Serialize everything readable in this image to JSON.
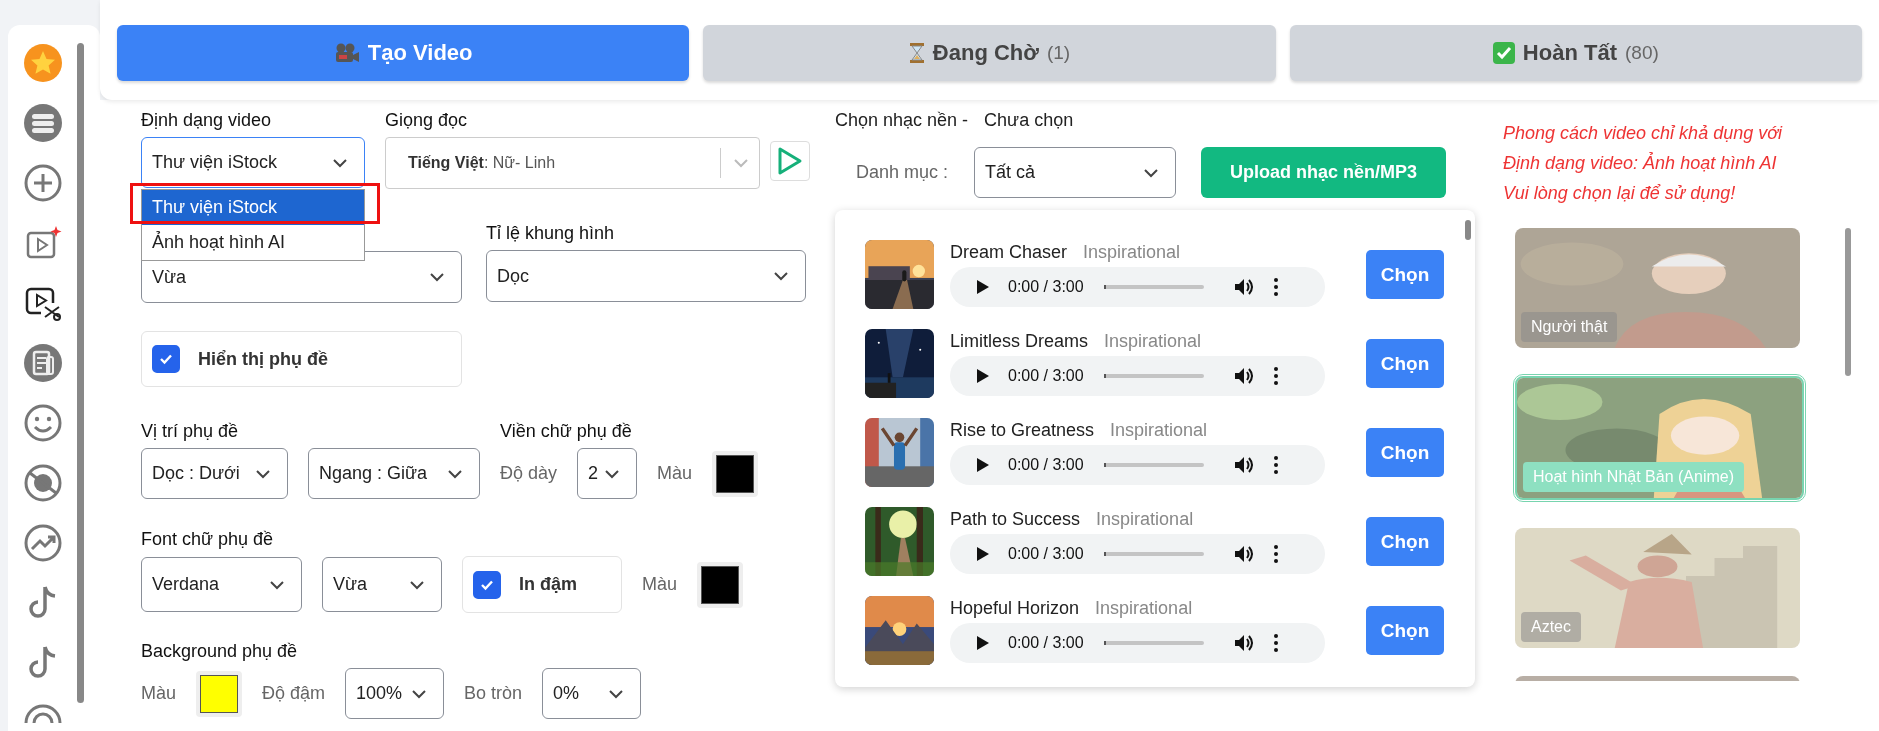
{
  "tabs": [
    {
      "label": "Tạo Video",
      "selected": true
    },
    {
      "label": "Đang Chờ",
      "count": "(1)",
      "selected": false
    },
    {
      "label": "Hoàn Tất",
      "count": "(80)",
      "selected": false
    }
  ],
  "form": {
    "video_format": {
      "label": "Định dạng video",
      "value": "Thư viện iStock",
      "options": [
        {
          "label": "Thư viện iStock",
          "selected": true,
          "highlighted": true
        },
        {
          "label": "Ảnh hoạt hình AI",
          "selected": false,
          "highlighted": false
        }
      ]
    },
    "voice": {
      "label": "Giọng đọc",
      "value": "**Tiếng Việt**: Nữ- Linh"
    },
    "size": {
      "value": "Vừa"
    },
    "aspect": {
      "label": "Tỉ lệ khung hình",
      "value": "Dọc"
    },
    "show_subtitles": {
      "label": "Hiển thị phụ đề",
      "checked": true
    },
    "subtitle_position": {
      "label": "Vị trí phụ đề",
      "vertical": "Dọc : Dưới",
      "horizontal": "Ngang : Giữa"
    },
    "subtitle_outline": {
      "label": "Viền chữ phụ đề",
      "thickness_label": "Độ dày",
      "thickness": "2",
      "color_label": "Màu",
      "color": "#000000"
    },
    "subtitle_font": {
      "label": "Font chữ phụ đề",
      "font": "Verdana",
      "size": "Vừa",
      "bold": {
        "label": "In đậm",
        "checked": true
      },
      "color_label": "Màu",
      "color": "#000000"
    },
    "subtitle_background": {
      "label": "Background phụ đề",
      "color_label": "Màu",
      "color": "#ffff00",
      "opacity_label": "Độ đậm",
      "opacity": "100%",
      "radius_label": "Bo tròn",
      "radius": "0%"
    }
  },
  "music": {
    "title": "Chọn nhạc nền -",
    "status": "Chưa chọn",
    "category_label": "Danh mục :",
    "category": "Tất cả",
    "upload_button": "Upload nhạc nền/MP3",
    "tracks": [
      {
        "title": "Dream Chaser",
        "genre": "Inspirational",
        "time": "0:00 / 3:00",
        "level": 0,
        "button": "Chọn"
      },
      {
        "title": "Limitless Dreams",
        "genre": "Inspirational",
        "time": "0:00 / 3:00",
        "level": 0,
        "button": "Chọn"
      },
      {
        "title": "Rise to Greatness",
        "genre": "Inspirational",
        "time": "0:00 / 3:00",
        "level": 0,
        "button": "Chọn"
      },
      {
        "title": "Path to Success",
        "genre": "Inspirational",
        "time": "0:00 / 3:00",
        "level": 0,
        "button": "Chọn"
      },
      {
        "title": "Hopeful Horizon",
        "genre": "Inspirational",
        "time": "0:00 / 3:00",
        "level": 0,
        "button": "Chọn"
      }
    ]
  },
  "style": {
    "notice": [
      "Phong cách video chỉ khả dụng với Định dạng video: Ảnh hoạt hình AI",
      "Vui lòng chọn lại để sử dụng!"
    ],
    "cards": [
      {
        "label": "Người thật",
        "selected": false
      },
      {
        "label": "Hoạt hình Nhật Bản (Anime)",
        "selected": true
      },
      {
        "label": "Aztec",
        "selected": false
      },
      {
        "selected": false
      }
    ]
  }
}
